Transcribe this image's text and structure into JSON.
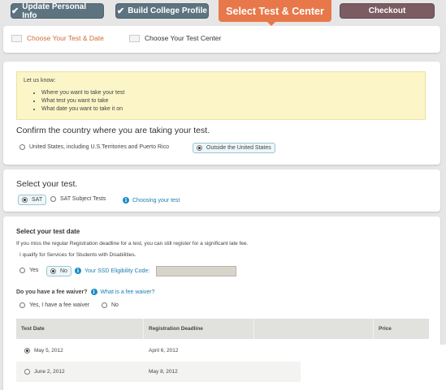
{
  "steps": {
    "update_personal_info": "Update Personal Info",
    "build_college_profile": "Build College Profile",
    "select_test_center": "Select Test & Center",
    "checkout": "Checkout",
    "check_icon": "check-icon"
  },
  "subtabs": {
    "choose_test_date": "Choose Your Test & Date",
    "choose_test_center": "Choose Your Test Center"
  },
  "notice": {
    "lead": "Let us know:",
    "items": [
      "Where you want to take your test",
      "What test you want to take",
      "What date you want to take it on"
    ]
  },
  "country": {
    "heading": "Confirm the country where you are taking your test.",
    "option_us": "United States, including U.S.Territories and Puerto Rico",
    "option_outside": "Outside the United States",
    "selected": "Outside the United States"
  },
  "test": {
    "heading": "Select your test.",
    "option_sat": "SAT",
    "option_subject": "SAT Subject Tests",
    "help_link": "Choosing your test",
    "selected": "SAT"
  },
  "test_date": {
    "heading": "Select your test date",
    "late_fee_note": "If you miss the regular Registration deadline for a test, you can still register for a significant late fee.",
    "ssd_question": "I qualify for Services for Students with Disabilities.",
    "yes": "Yes",
    "no": "No",
    "ssd_code_link": "Your SSD Eligibility Code:",
    "ssd_code_value": "",
    "ssd_selected": "No",
    "fee_heading": "Do you have a fee waiver?",
    "fee_link": "What is a fee waiver?",
    "fee_yes": "Yes, I have a fee waiver",
    "fee_no": "No"
  },
  "table": {
    "columns": [
      "Test Date",
      "Registration Deadline",
      "",
      "Price"
    ],
    "rows": [
      {
        "date": "May 5, 2012",
        "deadline": "April 6, 2012",
        "selected": true
      },
      {
        "date": "June 2, 2012",
        "deadline": "May 8, 2012",
        "selected": false
      }
    ]
  },
  "colors": {
    "active_step": "#e8784a",
    "done_step": "#5d7480",
    "checkout_step": "#7a5c62",
    "notice_bg": "#fbf5c8",
    "link": "#1a7eb0"
  }
}
